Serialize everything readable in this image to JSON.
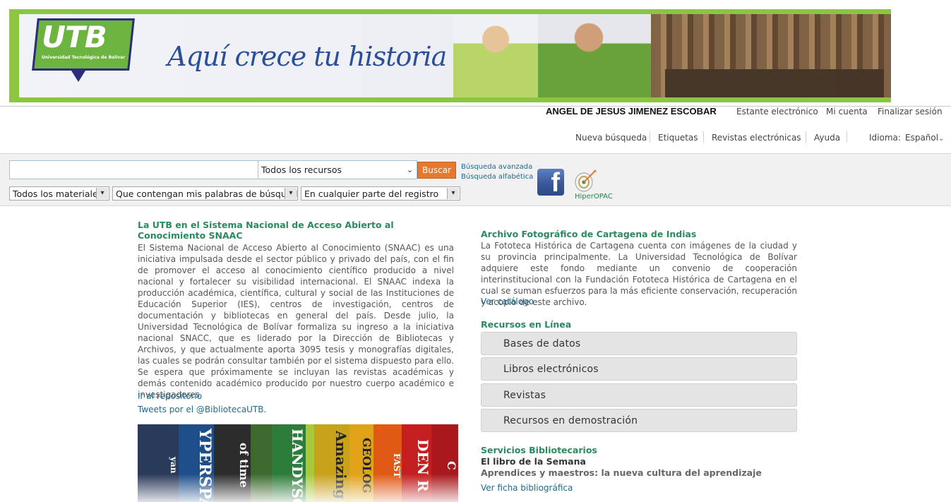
{
  "banner": {
    "logo_text": "UTB",
    "logo_subtext": "Universidad Tecnológica de Bolívar",
    "slogan": "Aquí crece tu historia"
  },
  "user_bar": {
    "user_name": "ANGEL DE JESUS JIMENEZ ESCOBAR",
    "links": [
      "Estante electrónico",
      "Mi cuenta",
      "Finalizar sesión"
    ]
  },
  "nav": {
    "items": [
      "Nueva búsqueda",
      "Etiquetas",
      "Revistas electrónicas",
      "Ayuda"
    ],
    "language_label": "Idioma:",
    "language_value": "Español"
  },
  "search": {
    "query": "",
    "scope_value": "Todos los recursos",
    "button_label": "Buscar",
    "advanced_link": "Búsqueda avanzada",
    "alpha_link": "Búsqueda alfabética",
    "material_value": "Todos los materiales",
    "match_value": "Que contengan mis palabras de búsqueda",
    "field_value": "En cualquier parte del registro",
    "hiperopac_label": "HiperOPAC"
  },
  "left": {
    "snaac_title": "La UTB en el Sistema Nacional de Acceso Abierto al Conocimiento SNAAC",
    "snaac_body": "El Sistema Nacional de Acceso Abierto al Conocimiento (SNAAC) es una iniciativa impulsada desde el sector público y privado del país, con el fin de promover el acceso al conocimiento científico producido a nivel nacional y fortalecer su visibilidad internacional. El SNAAC indexa la producción académica, científica, cultural y social de las Instituciones de Educación Superior (IES), centros de investigación, centros de documentación y bibliotecas en general del país. Desde julio, la Universidad Tecnológica de Bolívar formaliza su ingreso a la iniciativa nacional SNACC, que es liderado por la Dirección de Bibliotecas y Archivos, y que actualmente aporta 3095 tesis y monografías digitales, las cuales se podrán consultar también por el sistema dispuesto para ello. Se espera que próximamente se incluyan las revistas académicas y demás contenido académico producido por nuestro cuerpo académico e investigadores",
    "repo_link": "Ir al repositorio",
    "tweets_link": "Tweets por el @BibliotecaUTB.",
    "book_spines": [
      "yan",
      "YPERSPA",
      "of time",
      "HANDYSC",
      "Amazing",
      "GEOLOG",
      "FAST",
      "DEN R",
      "C"
    ]
  },
  "right": {
    "archivo_title": "Archivo Fotográfico de Cartagena de Indias",
    "archivo_body": "La Fototeca Histórica de Cartagena cuenta con imágenes de la ciudad y su provincia principalmente. La Universidad Tecnológica de Bolívar adquiere este fondo mediante un convenio de cooperación interinstitucional con la Fundación Fototeca Histórica de Cartagena en el cual se suman esfuerzos para la más eficiente conservación, recuperación y acopio de este archivo.",
    "catalog_link": "Ver catálogo",
    "recursos_title": "Recursos en Línea",
    "resources": [
      "Bases de datos",
      "Libros electrónicos",
      "Revistas",
      "Recursos en demostración"
    ],
    "servicios_title": "Servicios Bibliotecarios",
    "libro_title": "El libro de la Semana",
    "libro_name": "Aprendices y maestros: la nueva cultura del aprendizaje",
    "ficha_link": "Ver ficha bibliográfica"
  }
}
